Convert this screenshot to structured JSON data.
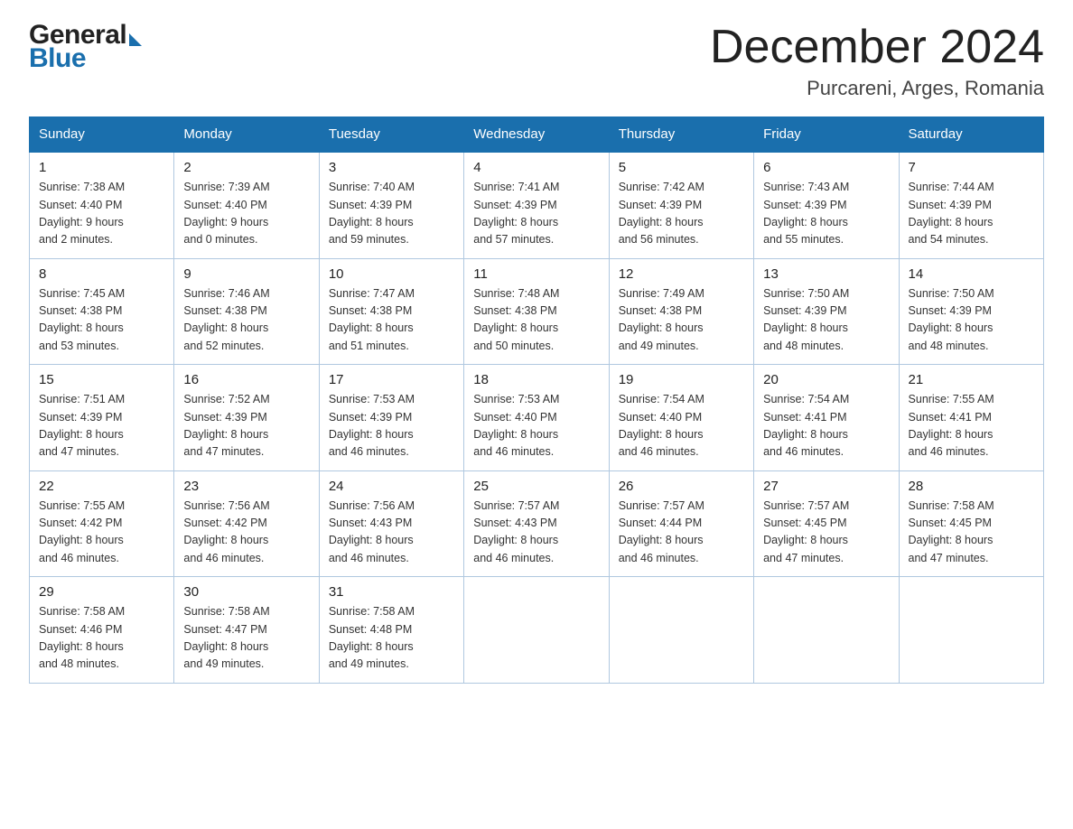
{
  "header": {
    "logo_general": "General",
    "logo_blue": "Blue",
    "title": "December 2024",
    "subtitle": "Purcareni, Arges, Romania"
  },
  "calendar": {
    "days_of_week": [
      "Sunday",
      "Monday",
      "Tuesday",
      "Wednesday",
      "Thursday",
      "Friday",
      "Saturday"
    ],
    "weeks": [
      [
        {
          "day": "1",
          "sunrise": "7:38 AM",
          "sunset": "4:40 PM",
          "daylight": "9 hours and 2 minutes."
        },
        {
          "day": "2",
          "sunrise": "7:39 AM",
          "sunset": "4:40 PM",
          "daylight": "9 hours and 0 minutes."
        },
        {
          "day": "3",
          "sunrise": "7:40 AM",
          "sunset": "4:39 PM",
          "daylight": "8 hours and 59 minutes."
        },
        {
          "day": "4",
          "sunrise": "7:41 AM",
          "sunset": "4:39 PM",
          "daylight": "8 hours and 57 minutes."
        },
        {
          "day": "5",
          "sunrise": "7:42 AM",
          "sunset": "4:39 PM",
          "daylight": "8 hours and 56 minutes."
        },
        {
          "day": "6",
          "sunrise": "7:43 AM",
          "sunset": "4:39 PM",
          "daylight": "8 hours and 55 minutes."
        },
        {
          "day": "7",
          "sunrise": "7:44 AM",
          "sunset": "4:39 PM",
          "daylight": "8 hours and 54 minutes."
        }
      ],
      [
        {
          "day": "8",
          "sunrise": "7:45 AM",
          "sunset": "4:38 PM",
          "daylight": "8 hours and 53 minutes."
        },
        {
          "day": "9",
          "sunrise": "7:46 AM",
          "sunset": "4:38 PM",
          "daylight": "8 hours and 52 minutes."
        },
        {
          "day": "10",
          "sunrise": "7:47 AM",
          "sunset": "4:38 PM",
          "daylight": "8 hours and 51 minutes."
        },
        {
          "day": "11",
          "sunrise": "7:48 AM",
          "sunset": "4:38 PM",
          "daylight": "8 hours and 50 minutes."
        },
        {
          "day": "12",
          "sunrise": "7:49 AM",
          "sunset": "4:38 PM",
          "daylight": "8 hours and 49 minutes."
        },
        {
          "day": "13",
          "sunrise": "7:50 AM",
          "sunset": "4:39 PM",
          "daylight": "8 hours and 48 minutes."
        },
        {
          "day": "14",
          "sunrise": "7:50 AM",
          "sunset": "4:39 PM",
          "daylight": "8 hours and 48 minutes."
        }
      ],
      [
        {
          "day": "15",
          "sunrise": "7:51 AM",
          "sunset": "4:39 PM",
          "daylight": "8 hours and 47 minutes."
        },
        {
          "day": "16",
          "sunrise": "7:52 AM",
          "sunset": "4:39 PM",
          "daylight": "8 hours and 47 minutes."
        },
        {
          "day": "17",
          "sunrise": "7:53 AM",
          "sunset": "4:39 PM",
          "daylight": "8 hours and 46 minutes."
        },
        {
          "day": "18",
          "sunrise": "7:53 AM",
          "sunset": "4:40 PM",
          "daylight": "8 hours and 46 minutes."
        },
        {
          "day": "19",
          "sunrise": "7:54 AM",
          "sunset": "4:40 PM",
          "daylight": "8 hours and 46 minutes."
        },
        {
          "day": "20",
          "sunrise": "7:54 AM",
          "sunset": "4:41 PM",
          "daylight": "8 hours and 46 minutes."
        },
        {
          "day": "21",
          "sunrise": "7:55 AM",
          "sunset": "4:41 PM",
          "daylight": "8 hours and 46 minutes."
        }
      ],
      [
        {
          "day": "22",
          "sunrise": "7:55 AM",
          "sunset": "4:42 PM",
          "daylight": "8 hours and 46 minutes."
        },
        {
          "day": "23",
          "sunrise": "7:56 AM",
          "sunset": "4:42 PM",
          "daylight": "8 hours and 46 minutes."
        },
        {
          "day": "24",
          "sunrise": "7:56 AM",
          "sunset": "4:43 PM",
          "daylight": "8 hours and 46 minutes."
        },
        {
          "day": "25",
          "sunrise": "7:57 AM",
          "sunset": "4:43 PM",
          "daylight": "8 hours and 46 minutes."
        },
        {
          "day": "26",
          "sunrise": "7:57 AM",
          "sunset": "4:44 PM",
          "daylight": "8 hours and 46 minutes."
        },
        {
          "day": "27",
          "sunrise": "7:57 AM",
          "sunset": "4:45 PM",
          "daylight": "8 hours and 47 minutes."
        },
        {
          "day": "28",
          "sunrise": "7:58 AM",
          "sunset": "4:45 PM",
          "daylight": "8 hours and 47 minutes."
        }
      ],
      [
        {
          "day": "29",
          "sunrise": "7:58 AM",
          "sunset": "4:46 PM",
          "daylight": "8 hours and 48 minutes."
        },
        {
          "day": "30",
          "sunrise": "7:58 AM",
          "sunset": "4:47 PM",
          "daylight": "8 hours and 49 minutes."
        },
        {
          "day": "31",
          "sunrise": "7:58 AM",
          "sunset": "4:48 PM",
          "daylight": "8 hours and 49 minutes."
        },
        null,
        null,
        null,
        null
      ]
    ],
    "sunrise_label": "Sunrise:",
    "sunset_label": "Sunset:",
    "daylight_label": "Daylight:"
  }
}
